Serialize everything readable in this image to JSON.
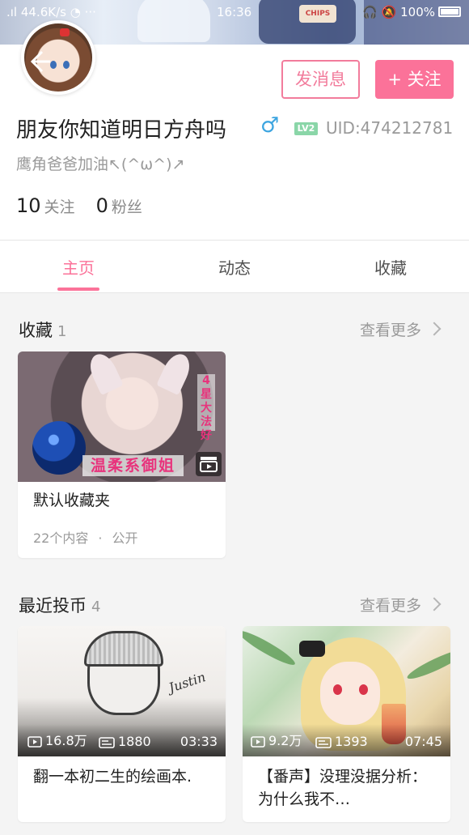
{
  "status_bar": {
    "left": ".ıl 44.6K/s ◔ ···",
    "time": "16:36",
    "right": "🎧 🔕 100%"
  },
  "header": {
    "message_button": "发消息",
    "follow_button": "+ 关注"
  },
  "profile": {
    "username": "朋友你知道明日方舟吗",
    "gender_symbol": "♂",
    "level_badge": "LV2",
    "uid": "UID:474212781",
    "signature": "鹰角爸爸加油↖(^ω^)↗",
    "following_count": "10",
    "following_label": "关注",
    "followers_count": "0",
    "followers_label": "粉丝"
  },
  "tabs": {
    "home": "主页",
    "dynamics": "动态",
    "favorites": "收藏",
    "active": "home"
  },
  "favorites_section": {
    "title": "收藏",
    "count": "1",
    "see_more": "查看更多",
    "folder": {
      "thumb_vertical_text": "4星大法好",
      "thumb_tag": "温柔系御姐",
      "name": "默认收藏夹",
      "content_count": "22个内容",
      "visibility": "公开"
    }
  },
  "coins_section": {
    "title": "最近投币",
    "count": "4",
    "see_more": "查看更多",
    "videos": [
      {
        "views": "16.8万",
        "danmaku": "1880",
        "duration": "03:33",
        "title": "翻一本初二生的绘画本.",
        "thumb_signature": "Justin"
      },
      {
        "views": "9.2万",
        "danmaku": "1393",
        "duration": "07:45",
        "title": "【番声】没理没据分析：为什么我不…"
      }
    ]
  },
  "colors": {
    "accent_pink": "#fb7299",
    "uid_gray": "#9a9a9a",
    "gender_blue": "#3da5e0",
    "level_green": "#8ad6a8"
  }
}
